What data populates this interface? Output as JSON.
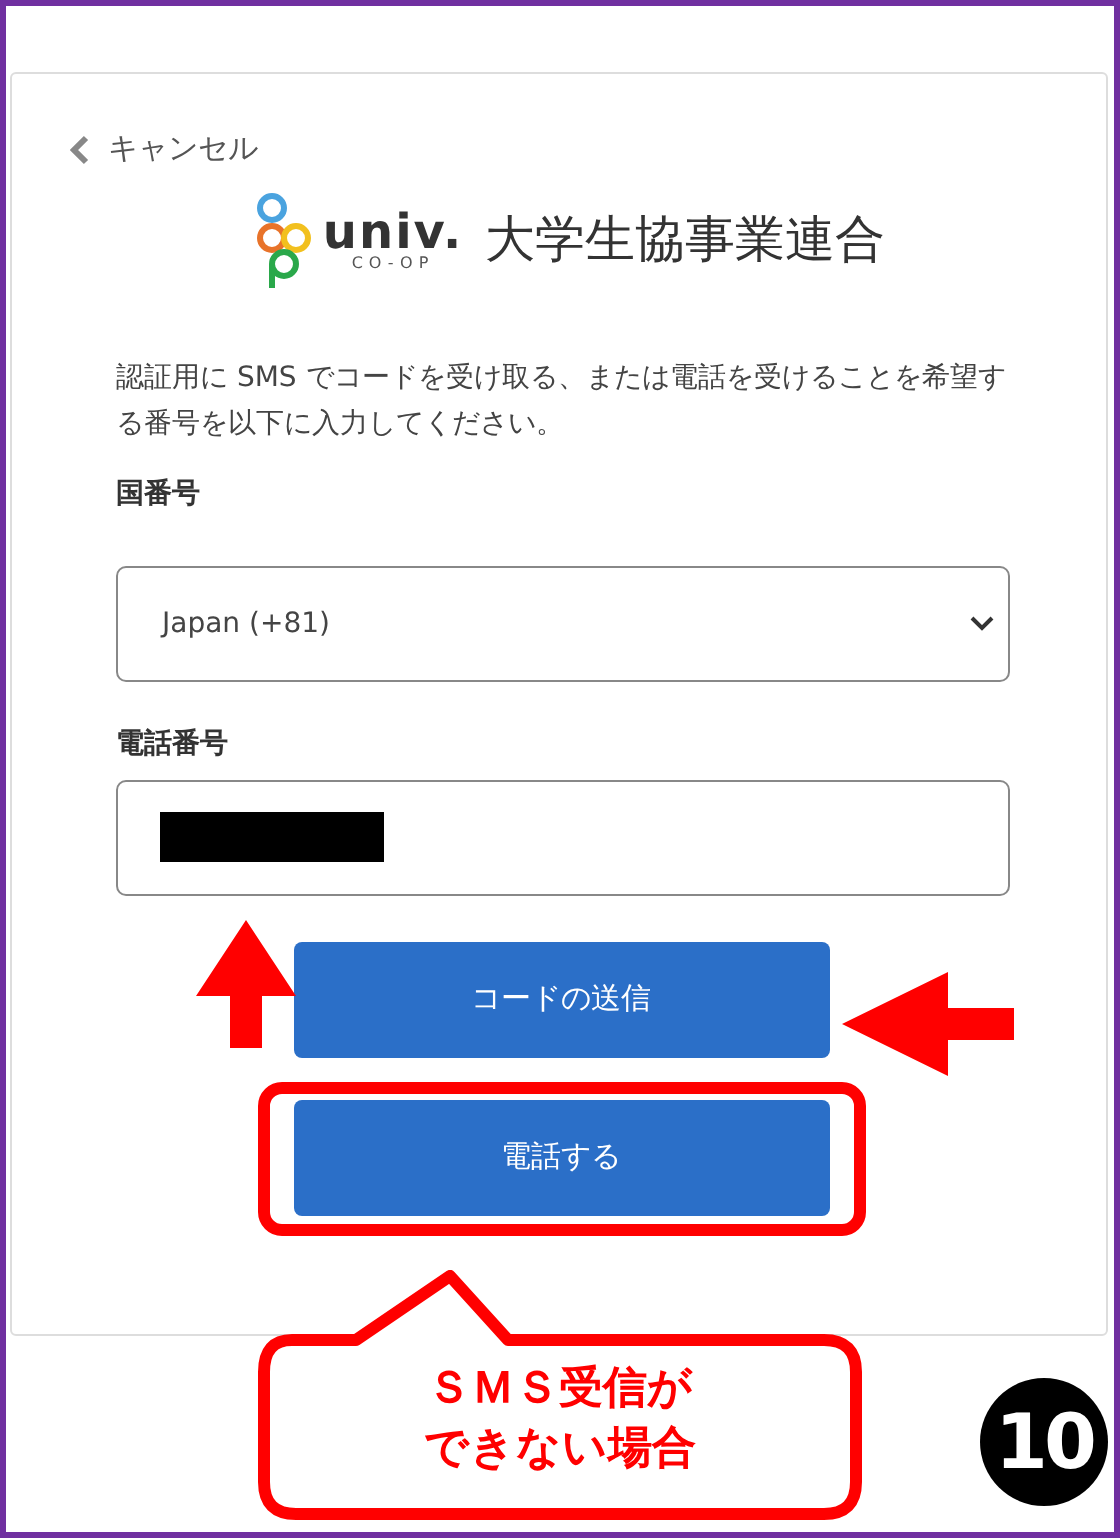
{
  "cancel_link": {
    "label": "キャンセル"
  },
  "logo": {
    "wordmark": "univ.",
    "subtitle": "CO-OP",
    "organization": "大学生協事業連合"
  },
  "instructions": "認証用に SMS でコードを受け取る、または電話を受けることを希望する番号を以下に入力してください。",
  "country_field": {
    "label": "国番号",
    "value": "Japan (+81)"
  },
  "phone_field": {
    "label": "電話番号",
    "redacted": true
  },
  "buttons": [
    {
      "label": "コードの送信",
      "highlighted": false
    },
    {
      "label": "電話する",
      "highlighted": true
    }
  ],
  "callout": {
    "text": "ＳＭＳ受信ができない場合"
  },
  "step_badge": "10"
}
